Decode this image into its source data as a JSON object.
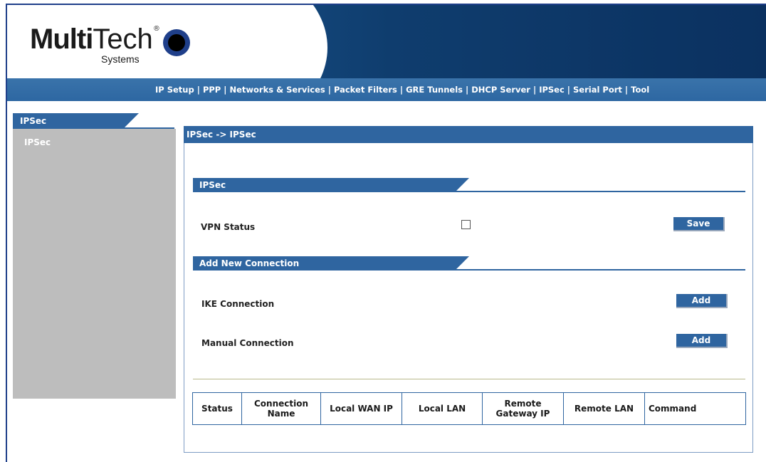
{
  "header": {
    "logo_multi": "Multi",
    "logo_tech": "Tech",
    "logo_systems": "Systems",
    "brand_color": "#2f65a0"
  },
  "nav": {
    "items": [
      "IP Setup",
      "PPP",
      "Networks & Services",
      "Packet Filters",
      "GRE Tunnels",
      "DHCP Server",
      "IPSec",
      "Serial Port",
      "Tool"
    ]
  },
  "sidebar": {
    "title": "IPSec",
    "items": [
      "IPSec"
    ]
  },
  "main": {
    "breadcrumb": "IPSec -> IPSec",
    "ipsec_section": {
      "title": "IPSec",
      "vpn_status_label": "VPN Status",
      "vpn_status_checked": false,
      "save_label": "Save"
    },
    "add_section": {
      "title": "Add New Connection",
      "ike_label": "IKE Connection",
      "manual_label": "Manual Connection",
      "add_label": "Add"
    },
    "table": {
      "columns": [
        "Status",
        "Connection Name",
        "Local WAN IP",
        "Local LAN",
        "Remote Gateway IP",
        "Remote LAN",
        "Command"
      ],
      "rows": []
    }
  }
}
